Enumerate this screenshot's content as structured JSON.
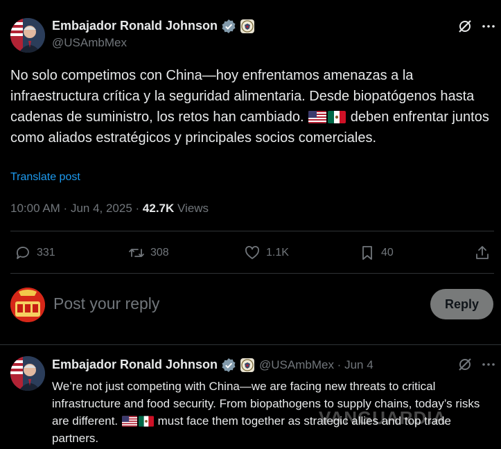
{
  "post": {
    "author_name": "Embajador Ronald Johnson",
    "handle": "@USAmbMex",
    "text_part1": "No solo competimos con China—hoy enfrentamos amenazas a la infraestructura crítica y la seguridad alimentaria. Desde biopatógenos hasta cadenas de suministro, los retos han cambiado.",
    "text_part2": "deben enfrentar juntos como aliados estratégicos y principales socios comerciales.",
    "translate_label": "Translate post",
    "time": "10:00 AM",
    "date": "Jun 4, 2025",
    "views_count": "42.7K",
    "views_label": "Views"
  },
  "actions": {
    "replies": "331",
    "reposts": "308",
    "likes": "1.1K",
    "bookmarks": "40"
  },
  "reply_box": {
    "placeholder": "Post your reply",
    "button_label": "Reply"
  },
  "quoted": {
    "author_name": "Embajador Ronald Johnson",
    "handle": "@USAmbMex",
    "date": "Jun 4",
    "text_part1": "We’re not just competing with China—we are facing new threats to critical infrastructure and food security. From biopathogens to supply chains, today’s risks are different.",
    "text_part2": "must face them together as strategic allies and top trade partners."
  },
  "watermark": "VANGUARDIA",
  "icons": [
    "verified-badge-icon",
    "seal-icon",
    "grok-icon",
    "more-icon",
    "reply-icon",
    "repost-icon",
    "like-icon",
    "bookmark-icon",
    "share-icon",
    "us-flag-icon",
    "mexico-flag-icon"
  ],
  "colors": {
    "background": "#000000",
    "text": "#e7e9ea",
    "muted": "#71767b",
    "link": "#1d9bf0",
    "verified": "#829aab",
    "divider": "#2f3336"
  }
}
